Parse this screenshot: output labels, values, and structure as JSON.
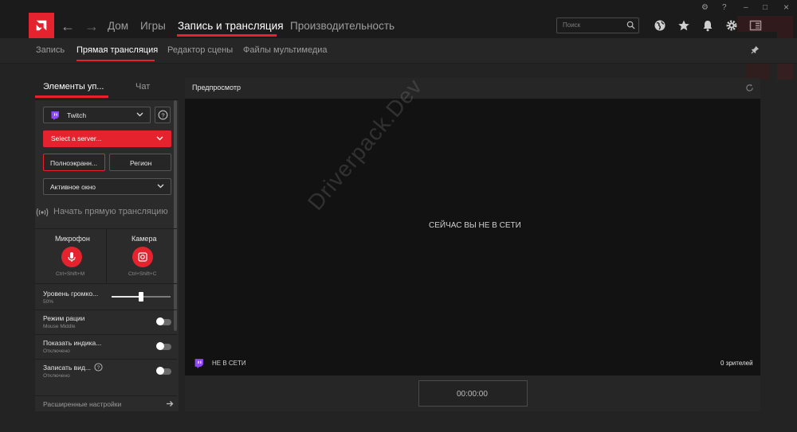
{
  "window": {
    "controls": [
      "⚙",
      "?",
      "–",
      "□",
      "×"
    ]
  },
  "nav": {
    "back": "←",
    "forward": "→",
    "items": [
      "Дом",
      "Игры",
      "Запись и трансляция",
      "Производительность"
    ],
    "active_index": 2
  },
  "search": {
    "placeholder": "Поиск"
  },
  "subnav": {
    "items": [
      "Запись",
      "Прямая трансляция",
      "Редактор сцены",
      "Файлы мультимедиа"
    ],
    "active_index": 1
  },
  "left": {
    "tabs": [
      "Элементы уп...",
      "Чат"
    ],
    "platform": "Twitch",
    "help": "?",
    "server": "Select a server...",
    "fullscreen": "Полноэкранн...",
    "region": "Регион",
    "capture_mode": "Активное окно",
    "start_stream": "Начать прямую трансляцию",
    "mic": {
      "label": "Микрофон",
      "hotkey": "Ctrl+Shift+M"
    },
    "camera": {
      "label": "Камера",
      "hotkey": "Ctrl+Shift+C"
    },
    "volume": {
      "label": "Уровень громко...",
      "value": "50%",
      "level": 0.5
    },
    "walkie": {
      "label": "Режим рации",
      "sub": "Mouse Middle"
    },
    "show_indicator": {
      "label": "Показать индика...",
      "sub": "Отключено"
    },
    "record_video": {
      "label": "Записать вид...",
      "sub": "Отключено"
    },
    "advanced": "Расширенные настройки"
  },
  "preview": {
    "title": "Предпросмотр",
    "offline_message": "СЕЙЧАС ВЫ НЕ В СЕТИ",
    "status": "НЕ В СЕТИ",
    "viewers": "0 зрителей",
    "timer": "00:00:00",
    "watermark": "Driverpack.Dev"
  },
  "colors": {
    "accent": "#e4232f",
    "bg": "#232323",
    "panel": "#2b2b2b",
    "preview_bg": "#121212"
  }
}
